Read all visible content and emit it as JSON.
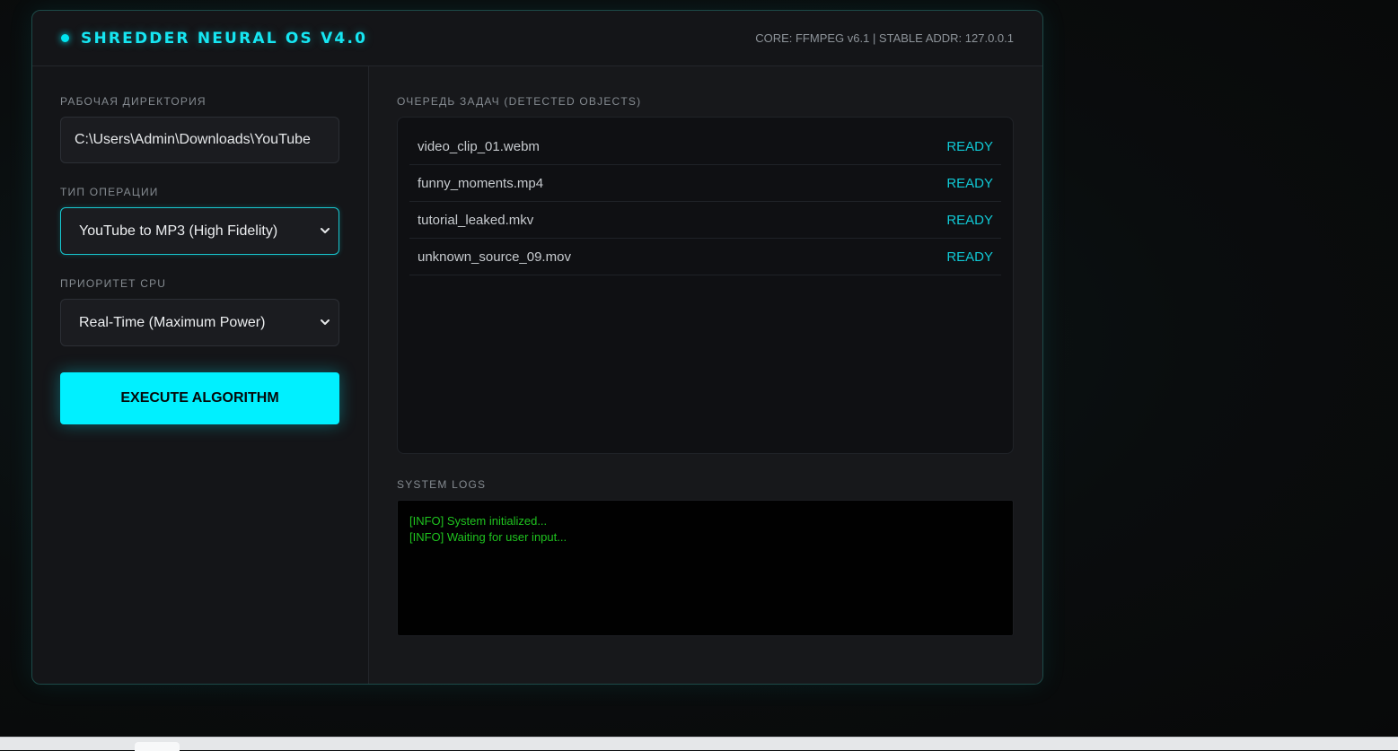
{
  "header": {
    "title": "SHREDDER NEURAL OS V4.0",
    "core_info": "CORE: FFMPEG v6.1 | STABLE ADDR: 127.0.0.1"
  },
  "sidebar": {
    "directory_label": "Рабочая директория",
    "directory_value": "C:\\Users\\Admin\\Downloads\\YouTube",
    "operation_label": "Тип операции",
    "operation_value": "YouTube to MP3 (High Fidelity)",
    "priority_label": "Приоритет CPU",
    "priority_value": "Real-Time (Maximum Power)",
    "execute_label": "EXECUTE ALGORITHM"
  },
  "queue": {
    "label": "Очередь задач (Detected Objects)",
    "items": [
      {
        "name": "video_clip_01.webm",
        "status": "READY"
      },
      {
        "name": "funny_moments.mp4",
        "status": "READY"
      },
      {
        "name": "tutorial_leaked.mkv",
        "status": "READY"
      },
      {
        "name": "unknown_source_09.mov",
        "status": "READY"
      }
    ]
  },
  "logs": {
    "label": "System Logs",
    "lines": [
      "[INFO] System initialized...",
      "[INFO] Waiting for user input..."
    ]
  },
  "colors": {
    "accent": "#00f0ff",
    "log_text": "#1fc41f",
    "panel_border": "#1d4a48"
  }
}
